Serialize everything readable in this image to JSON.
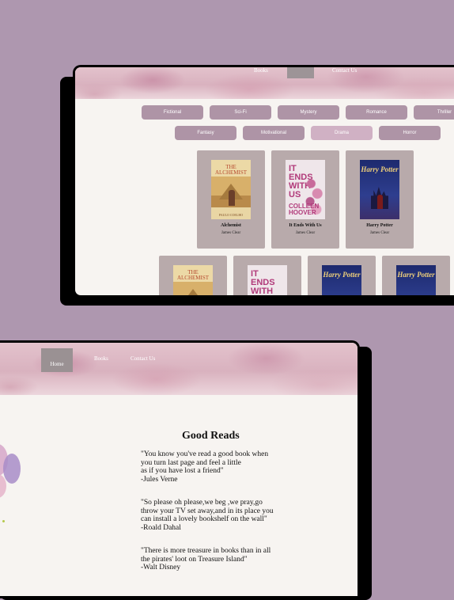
{
  "top_screen": {
    "nav": {
      "books": "Books",
      "contact": "Contact Us"
    },
    "genres_row1": [
      "Fictional",
      "Sci-Fi",
      "Mystery",
      "Romance",
      "Thriller"
    ],
    "genres_row2": [
      "Fantasy",
      "Motivational",
      "Drama",
      "Horror"
    ],
    "active_genre": "Drama",
    "books": [
      {
        "title": "Alchemist",
        "author": "James Clear",
        "cover_title": "THE ALCHEMIST",
        "cover_author": "PAULO COELHO"
      },
      {
        "title": "It Ends With Us",
        "author": "James Clear",
        "cover_title": "IT ENDS WITH US",
        "cover_author": "COLLEEN HOOVER"
      },
      {
        "title": "Harry Potter",
        "author": "James Clear",
        "cover_title": "Harry Potter"
      }
    ]
  },
  "bottom_screen": {
    "nav": {
      "home": "Home",
      "books": "Books",
      "contact": "Contact Us"
    },
    "title": "Good Reads",
    "quotes": [
      {
        "lines": [
          "\"You know you've read a good book when",
          "you turn last page and feel a little",
          "as if you have lost a friend\"",
          "-Jules Verne"
        ]
      },
      {
        "lines": [
          "\"So please oh please,we beg ,we pray,go",
          "throw your TV set away,and in its place you",
          "can install a lovely bookshelf on the wall\"",
          "-Roald Dahal"
        ]
      },
      {
        "lines": [
          "\"There is more treasure in books than in all",
          "the pirates' loot on Treasure Island\"",
          "-Walt Disney"
        ]
      }
    ]
  },
  "colors": {
    "background": "#ae97af",
    "pill": "#ae94a6",
    "pill_active": "#d0b1c4",
    "card": "#b8aaab"
  }
}
